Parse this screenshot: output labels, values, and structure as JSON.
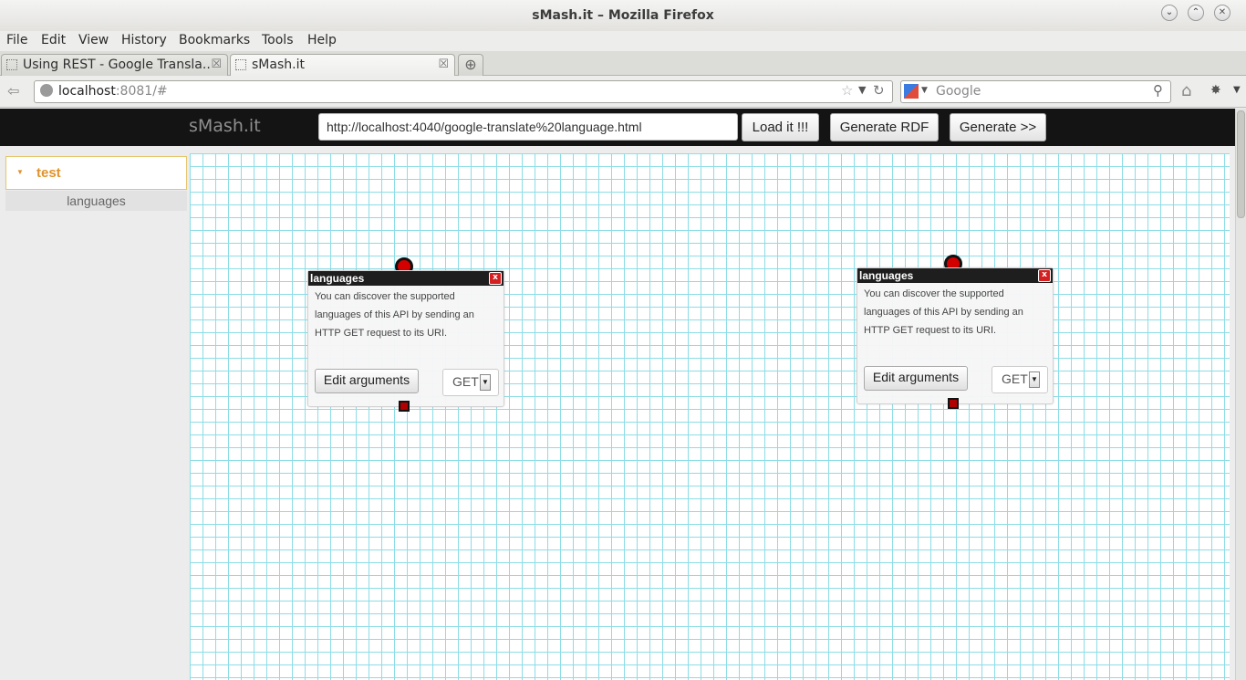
{
  "window": {
    "title": "sMash.it – Mozilla Firefox"
  },
  "menu": [
    "File",
    "Edit",
    "View",
    "History",
    "Bookmarks",
    "Tools",
    "Help"
  ],
  "tabs": [
    {
      "label": "Using REST - Google Transla..."
    },
    {
      "label": "sMash.it"
    }
  ],
  "nav": {
    "url_host": "localhost",
    "url_rest": ":8081/#",
    "search_placeholder": "Google"
  },
  "app": {
    "title": "sMash.it",
    "url_input_value": "http://localhost:4040/google-translate%20language.html",
    "load_button": "Load it !!!",
    "generate_rdf_button": "Generate RDF",
    "generate_button": "Generate >>"
  },
  "sidebar": {
    "group": "test",
    "items": [
      {
        "label": "languages"
      }
    ]
  },
  "modules": [
    {
      "title": "languages",
      "close": "x",
      "description": "You can discover the supported languages of this API by sending an HTTP GET request to its URI.",
      "edit_label": "Edit arguments",
      "method": "GET"
    },
    {
      "title": "languages",
      "close": "x",
      "description": "You can discover the supported languages of this API by sending an HTTP GET request to its URI.",
      "edit_label": "Edit arguments",
      "method": "GET"
    }
  ],
  "colors": {
    "header_bg": "#141414",
    "grid": "#8cdde6",
    "sidebar_accent": "#e0932c",
    "terminal": "#d40000"
  }
}
